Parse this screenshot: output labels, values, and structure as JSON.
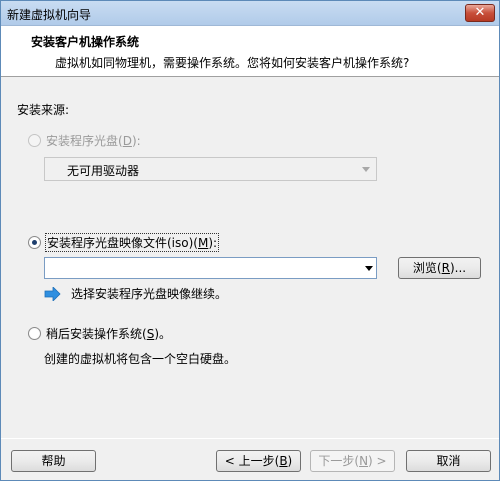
{
  "window": {
    "title": "新建虚拟机向导",
    "close_label": "✕"
  },
  "header": {
    "title": "安装客户机操作系统",
    "subtitle": "虚拟机如同物理机，需要操作系统。您将如何安装客户机操作系统?"
  },
  "source": {
    "label": "安装来源:",
    "disc_option": {
      "label": "安装程序光盘(",
      "key": "D",
      "suffix": "):",
      "selected": false,
      "enabled": false
    },
    "disc_combo": {
      "value": "无可用驱动器",
      "enabled": false
    },
    "iso_option": {
      "label": "安装程序光盘映像文件(iso)(",
      "key": "M",
      "suffix": "):",
      "selected": true
    },
    "iso_input": {
      "value": "",
      "placeholder": ""
    },
    "browse_button": {
      "label": "浏览(",
      "key": "R",
      "suffix": ")..."
    },
    "iso_hint": "选择安装程序光盘映像继续。",
    "later_option": {
      "label": "稍后安装操作系统(",
      "key": "S",
      "suffix": ")。",
      "selected": false
    },
    "later_desc": "创建的虚拟机将包含一个空白硬盘。"
  },
  "footer": {
    "help_label": "帮助",
    "back_button": {
      "label": "< 上一步(",
      "key": "B",
      "suffix": ")",
      "enabled": true
    },
    "next_button": {
      "label": "下一步(",
      "key": "N",
      "suffix": ") >",
      "enabled": false
    },
    "cancel_label": "取消"
  },
  "colors": {
    "titlebar": "#b9d1ea",
    "close": "#c84f3a",
    "info_arrow": "#2f8fe0"
  },
  "icons": {
    "close": "close-icon",
    "info": "arrow-right-icon",
    "dropdown": "chevron-down-icon"
  }
}
